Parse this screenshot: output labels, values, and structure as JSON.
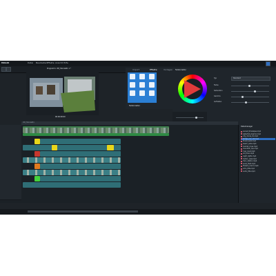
{
  "app": {
    "logo": "MAGIX",
    "menu": [
      "Datei",
      "Bearbeiten",
      "Effekte",
      "Ansicht",
      "Hilfe"
    ]
  },
  "preview": {
    "title": "Programm: VM_Tutorial01 1 *",
    "timecode": "00:00:00:00"
  },
  "effects": {
    "tabs": [
      "Import",
      "Effekte",
      "Vorlagen",
      "Audio",
      "Store"
    ],
    "selected_tab": "Effekte",
    "group_label": "Farbkorrektur"
  },
  "properties": {
    "title": "Farbkorrektur",
    "row_labels": [
      "Farbe",
      "Helligkeit",
      "Sättigung",
      "Transparenz"
    ],
    "dropdown_value": "Standard",
    "right_labels": [
      "Typ",
      "Farbe",
      "Saturation",
      "Gamma",
      "Aufhellen"
    ]
  },
  "timeline": {
    "header_label": "VM_Tutorial01",
    "tracks": [
      1,
      2,
      3,
      4,
      5,
      6,
      7,
      8,
      9,
      10,
      11,
      12,
      13,
      14
    ]
  },
  "media": {
    "header": "Dateimanager",
    "items": [
      "sunset_timelapse.mp4",
      "waterfall_slowmo.mp4",
      "city_drone_01.mp4",
      "bridge_pan_02.mp4",
      "forest_walk.mp4",
      "beach_wide.mp4",
      "market_close.mp4",
      "mountain_top.mp4",
      "river_boat.mp4",
      "old_town.mp4",
      "night_lights.mp4",
      "harbor_view.mp4",
      "train_station.mp4",
      "snow_field.mp4",
      "flowers_macro.mp4",
      "intro_title.mp4",
      "outro_title.mp4"
    ],
    "selected_index": 3
  },
  "colors": {
    "accent": "#2e6ec2",
    "background": "#1e2328"
  }
}
